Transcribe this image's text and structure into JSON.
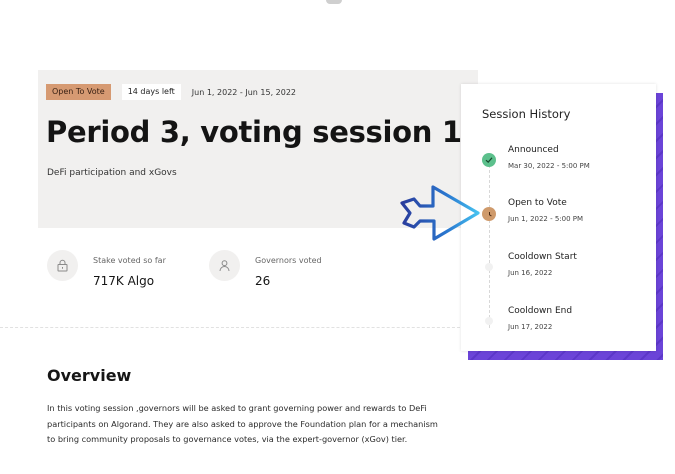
{
  "session": {
    "status_badge": "Open To Vote",
    "time_left": "14 days left",
    "date_range": "Jun 1, 2022 - Jun 15, 2022",
    "title": "Period 3, voting session 1",
    "subtitle": "DeFi participation and xGovs"
  },
  "stats": {
    "stake": {
      "label": "Stake voted so far",
      "value": "717K Algo",
      "icon": "lock-icon"
    },
    "governors": {
      "label": "Governors voted",
      "value": "26",
      "icon": "user-icon"
    }
  },
  "overview": {
    "title": "Overview",
    "text": "In this voting session ,governors will be asked to grant governing power and rewards to DeFi participants on Algorand. They are also asked to approve the Foundation plan for a mechanism to bring community proposals to governance votes, via the expert-governor (xGov) tier."
  },
  "history": {
    "title": "Session History",
    "steps": [
      {
        "name": "Announced",
        "date": "Mar 30, 2022 - 5:00 PM",
        "state": "done"
      },
      {
        "name": "Open to Vote",
        "date": "Jun 1, 2022 - 5:00 PM",
        "state": "current"
      },
      {
        "name": "Cooldown Start",
        "date": "Jun 16, 2022",
        "state": "upcoming"
      },
      {
        "name": "Cooldown End",
        "date": "Jun 17, 2022",
        "state": "upcoming"
      }
    ]
  },
  "colors": {
    "badge": "#d69a72",
    "accent_purple": "#6b44d8",
    "done_green": "#5cc08c",
    "current_orange": "#cf9a6b",
    "arrow_blue": "#2a78d0"
  }
}
